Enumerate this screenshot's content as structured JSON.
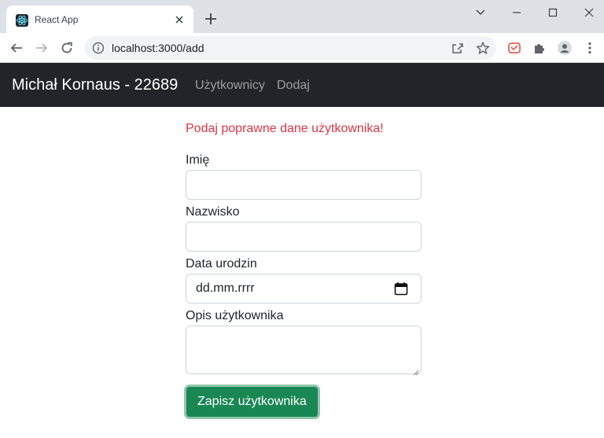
{
  "browser": {
    "tab_title": "React App",
    "url": "localhost:3000/add"
  },
  "navbar": {
    "brand": "Michał Kornaus - 22689",
    "links": [
      "Użytkownicy",
      "Dodaj"
    ]
  },
  "form": {
    "error_message": "Podaj poprawne dane użytkownika!",
    "first_name_label": "Imię",
    "first_name_value": "",
    "last_name_label": "Nazwisko",
    "last_name_value": "",
    "birth_date_label": "Data urodzin",
    "birth_date_placeholder": "dd.mm.rrrr",
    "description_label": "Opis użytkownika",
    "description_value": "",
    "submit_label": "Zapisz użytkownika"
  },
  "colors": {
    "navbar_bg": "#212529",
    "error": "#dc3545",
    "submit_bg": "#198754"
  }
}
